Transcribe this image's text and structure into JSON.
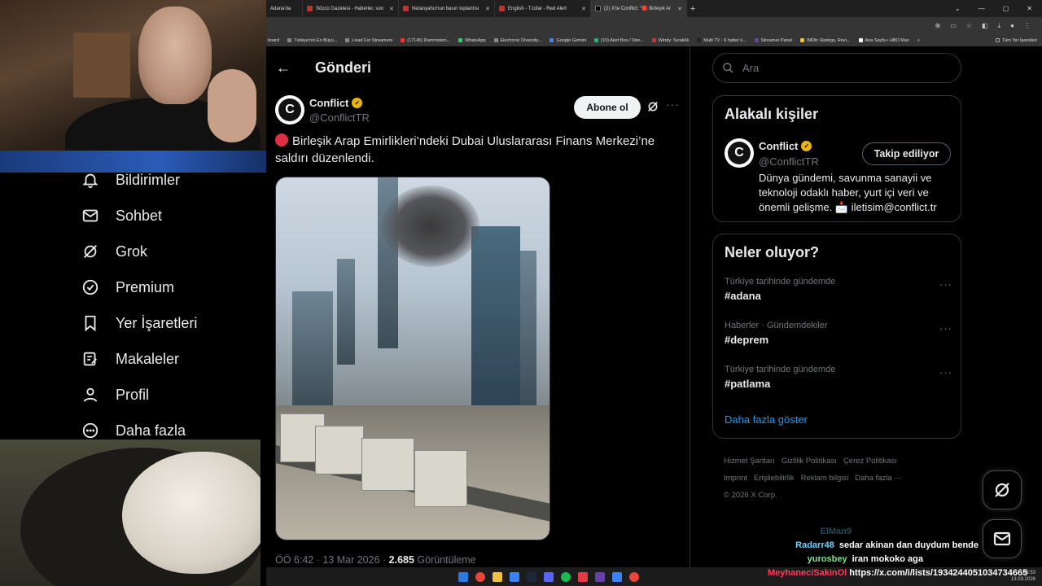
{
  "browser": {
    "tabs": [
      {
        "label": "Adana'da"
      },
      {
        "label": "Sözcü Gazetesi - Haberler, son"
      },
      {
        "label": "Netanyahu'nun basın toplantısı"
      },
      {
        "label": "English - Tzofar - Red Alert"
      },
      {
        "label": "(2) X'te Conflict: \"🔴 Birleşik Ar"
      }
    ],
    "bookmarks": [
      "board",
      "Türkiye'nin En Büyü...",
      "Livad For Streamers",
      "(17145) Rammstein...",
      "WhatsApp",
      "Electronic Diversity...",
      "Google Gemini",
      "(19) Alert Box / Stre...",
      "Windy: Sıcaklık",
      "Multi TV - 6 haber k...",
      "Streamer Panel",
      "IMDb: Ratings, Revi...",
      "Ana Sayfa • HBO Max"
    ],
    "bookmarks_more": "»",
    "bookmarks_right": "Tüm Yer İşaretleri"
  },
  "nav": {
    "items": [
      {
        "label": "Bildirimler",
        "icon": "bell-icon"
      },
      {
        "label": "Sohbet",
        "icon": "mail-icon"
      },
      {
        "label": "Grok",
        "icon": "grok-icon"
      },
      {
        "label": "Premium",
        "icon": "premium-icon"
      },
      {
        "label": "Yer İşaretleri",
        "icon": "bookmark-icon"
      },
      {
        "label": "Makaleler",
        "icon": "articles-icon"
      },
      {
        "label": "Profil",
        "icon": "profile-icon"
      },
      {
        "label": "Daha fazla",
        "icon": "more-circle-icon"
      }
    ]
  },
  "post": {
    "header_title": "Gönderi",
    "author_name": "Conflict",
    "author_handle": "@ConflictTR",
    "avatar_letter": "C",
    "follow_label": "Abone ol",
    "text": "Birleşik Arap Emirlikleri’ndeki Dubai Uluslararası Finans Merkezi’ne saldırı düzenlendi.",
    "time": "ÖÖ 6:42 · 13 Mar 2026 · ",
    "views_count": "2.685",
    "views_label": " Görüntüleme"
  },
  "sidebar": {
    "search_placeholder": "Ara",
    "related_title": "Alakalı kişiler",
    "related": {
      "name": "Conflict",
      "handle": "@ConflictTR",
      "button": "Takip ediliyor",
      "bio": "Dünya gündemi, savunma sanayii ve teknoloji odaklı haber, yurt içi veri ve önemli gelişme. 📩 iletisim@conflict.tr"
    },
    "trends_title": "Neler oluyor?",
    "trends": [
      {
        "context": "Türkiye tarihinde gündemde",
        "tag": "#adana"
      },
      {
        "context": "Haberler · Gündemdekiler",
        "tag": "#deprem"
      },
      {
        "context": "Türkiye tarihinde gündemde",
        "tag": "#patlama"
      }
    ],
    "show_more": "Daha fazla göster",
    "footer": [
      "Hizmet Şartları",
      "Gizlilik Politikası",
      "Çerez Politikası",
      "Imprint",
      "Erişilebilirlik",
      "Reklam bilgisi",
      "Daha fazla ···",
      "© 2026 X Corp."
    ]
  },
  "chat": [
    {
      "user": "ElMan9",
      "msg": ""
    },
    {
      "user": "Radarr48",
      "msg": "sedar akinan dan duydum bende"
    },
    {
      "user": "yurosbey",
      "msg": "iran mokoko aga"
    },
    {
      "user": "MeyhaneciSakinOl",
      "msg": "https://x.com/i/lists/1934244051034734665"
    }
  ],
  "taskbar": {
    "time": "06:53",
    "date": "13.03.2026"
  },
  "colors": {
    "accent": "#1d9bf0",
    "verified": "#e8b516",
    "follow_bg": "#eff3f4"
  }
}
